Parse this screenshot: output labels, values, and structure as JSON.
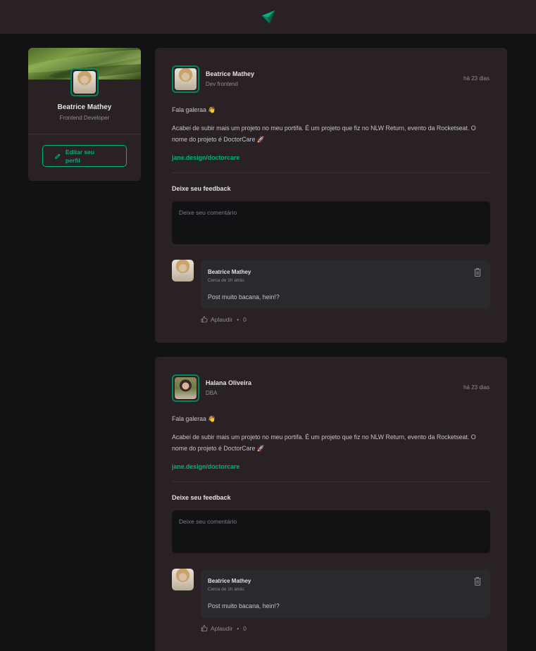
{
  "header": {
    "logo_icon": "paper-plane-icon",
    "accent": "#00b37e"
  },
  "sidebar": {
    "name": "Beatrice Mathey",
    "role": "Frontend Developer",
    "edit_label": "Editar seu perfil",
    "edit_icon": "pencil-icon"
  },
  "posts": [
    {
      "author": "Beatrice Mathey",
      "role": "Dev frontend",
      "time": "há 23 dias",
      "greeting": "Fala galeraa 👋",
      "body": "Acabei de subir mais um projeto no meu portifa. É um projeto que fiz no NLW Return, evento da Rocketseat. O nome do projeto é DoctorCare 🚀",
      "link": "jane.design/doctorcare",
      "feedback_title": "Deixe seu feedback",
      "feedback_placeholder": "Deixe seu comentário",
      "comment": {
        "author": "Beatrice Mathey",
        "time": "Cerca de 1h atrás",
        "text": "Post muito bacana, hein!?",
        "applaud_label": "Aplaudir",
        "applaud_count": "0"
      }
    },
    {
      "author": "Halana Oliveira",
      "role": "DBA",
      "time": "há 23 dias",
      "greeting": "Fala galeraa 👋",
      "body": "Acabei de subir mais um projeto no meu portifa. É um projeto que fiz no NLW Return, evento da Rocketseat. O nome do projeto é DoctorCare 🚀",
      "link": "jane.design/doctorcare",
      "feedback_title": "Deixe seu feedback",
      "feedback_placeholder": "Deixe seu comentário",
      "comment": {
        "author": "Beatrice Mathey",
        "time": "Cerca de 1h atrás",
        "text": "Post muito bacana, hein!?",
        "applaud_label": "Aplaudir",
        "applaud_count": "0"
      }
    }
  ]
}
